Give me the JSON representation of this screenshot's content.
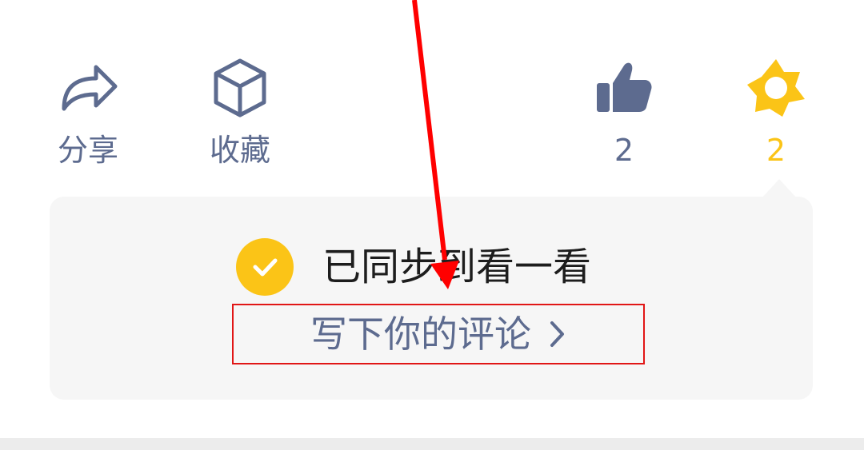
{
  "actions": {
    "share": {
      "label": "分享",
      "icon": "share-arrow-icon"
    },
    "favorite": {
      "label": "收藏",
      "icon": "cube-icon"
    },
    "like": {
      "count": "2",
      "icon": "thumbs-up-icon",
      "color": "#5d6b8f"
    },
    "wow": {
      "count": "2",
      "icon": "star-flower-icon",
      "color": "#fbc417"
    }
  },
  "sync_card": {
    "status_text": "已同步到看一看",
    "comment_link": "写下你的评论",
    "accent": "#fbc417"
  },
  "annotation": {
    "arrow_color": "#ff0000",
    "box_color": "#e11616"
  }
}
